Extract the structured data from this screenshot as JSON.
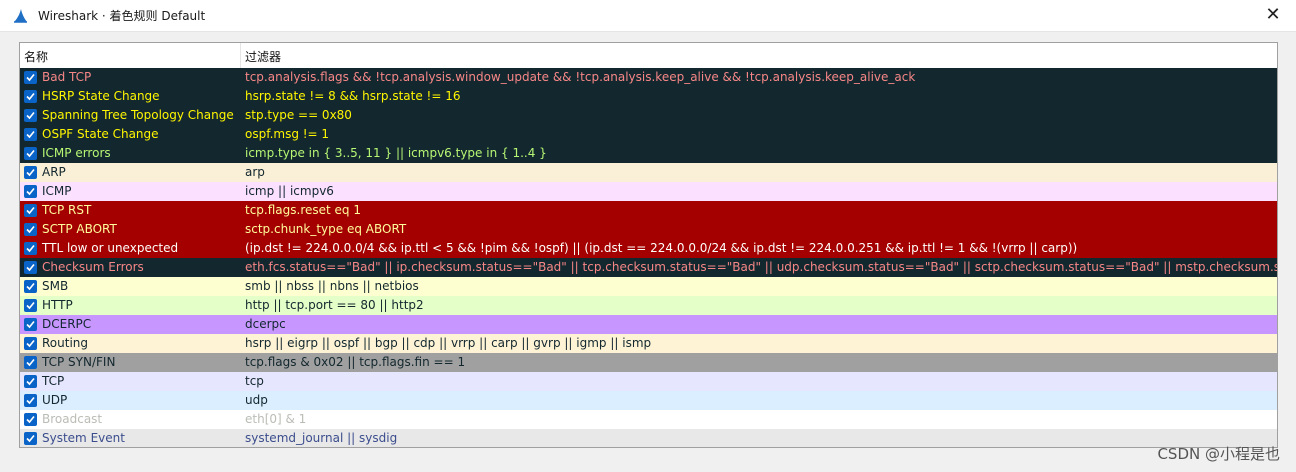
{
  "window": {
    "title": "Wireshark · 着色规则 Default",
    "close_glyph": "✕"
  },
  "table": {
    "columns": {
      "name": "名称",
      "filter": "过滤器"
    },
    "rows": [
      {
        "name": "Bad TCP",
        "filter": "tcp.analysis.flags && !tcp.analysis.window_update && !tcp.analysis.keep_alive && !tcp.analysis.keep_alive_ack",
        "checked": true,
        "bg": "#12272e",
        "fg": "#f78787"
      },
      {
        "name": "HSRP State Change",
        "filter": "hsrp.state != 8 && hsrp.state != 16",
        "checked": true,
        "bg": "#12272e",
        "fg": "#fff600"
      },
      {
        "name": "Spanning Tree Topology  Change",
        "filter": "stp.type == 0x80",
        "checked": true,
        "bg": "#12272e",
        "fg": "#fff600"
      },
      {
        "name": "OSPF State Change",
        "filter": "ospf.msg != 1",
        "checked": true,
        "bg": "#12272e",
        "fg": "#fff600"
      },
      {
        "name": "ICMP errors",
        "filter": "icmp.type in { 3..5, 11 } || icmpv6.type in { 1..4 }",
        "checked": true,
        "bg": "#12272e",
        "fg": "#b7f774"
      },
      {
        "name": "ARP",
        "filter": "arp",
        "checked": true,
        "bg": "#faf0d7",
        "fg": "#12272e"
      },
      {
        "name": "ICMP",
        "filter": "icmp || icmpv6",
        "checked": true,
        "bg": "#fce0ff",
        "fg": "#12272e"
      },
      {
        "name": "TCP RST",
        "filter": "tcp.flags.reset eq 1",
        "checked": true,
        "bg": "#a40000",
        "fg": "#fffc9c"
      },
      {
        "name": "SCTP ABORT",
        "filter": "sctp.chunk_type eq ABORT",
        "checked": true,
        "bg": "#a40000",
        "fg": "#fffc9c"
      },
      {
        "name": "TTL low or unexpected",
        "filter": "(ip.dst != 224.0.0.0/4 && ip.ttl < 5 && !pim && !ospf) || (ip.dst == 224.0.0.0/24 && ip.dst != 224.0.0.251 && ip.ttl != 1 && !(vrrp || carp))",
        "checked": true,
        "bg": "#a40000",
        "fg": "#fffffa"
      },
      {
        "name": "Checksum Errors",
        "filter": "eth.fcs.status==\"Bad\" || ip.checksum.status==\"Bad\" || tcp.checksum.status==\"Bad\" || udp.checksum.status==\"Bad\" || sctp.checksum.status==\"Bad\" || mstp.checksum.status==\"Bad\" || cdp.checksum.status==\"Bad\"",
        "checked": true,
        "bg": "#12272e",
        "fg": "#f78787"
      },
      {
        "name": "SMB",
        "filter": "smb || nbss || nbns || netbios",
        "checked": true,
        "bg": "#feffd0",
        "fg": "#12272e"
      },
      {
        "name": "HTTP",
        "filter": "http || tcp.port == 80 || http2",
        "checked": true,
        "bg": "#e4ffc7",
        "fg": "#12272e"
      },
      {
        "name": "DCERPC",
        "filter": "dcerpc",
        "checked": true,
        "bg": "#c797ff",
        "fg": "#12272e"
      },
      {
        "name": "Routing",
        "filter": "hsrp || eigrp || ospf || bgp || cdp || vrrp || carp || gvrp || igmp || ismp",
        "checked": true,
        "bg": "#fff3d6",
        "fg": "#12272e"
      },
      {
        "name": "TCP SYN/FIN",
        "filter": "tcp.flags & 0x02 || tcp.flags.fin == 1",
        "checked": true,
        "bg": "#a0a0a0",
        "fg": "#12272e"
      },
      {
        "name": "TCP",
        "filter": "tcp",
        "checked": true,
        "bg": "#e7e6ff",
        "fg": "#12272e"
      },
      {
        "name": "UDP",
        "filter": "udp",
        "checked": true,
        "bg": "#daeeff",
        "fg": "#12272e"
      },
      {
        "name": "Broadcast",
        "filter": "eth[0] & 1",
        "checked": true,
        "bg": "#ffffff",
        "fg": "#babdb6"
      },
      {
        "name": "System Event",
        "filter": "systemd_journal || sysdig",
        "checked": true,
        "bg": "#e8e8e8",
        "fg": "#3b4d8d"
      }
    ]
  },
  "watermark": "CSDN @小程是也"
}
